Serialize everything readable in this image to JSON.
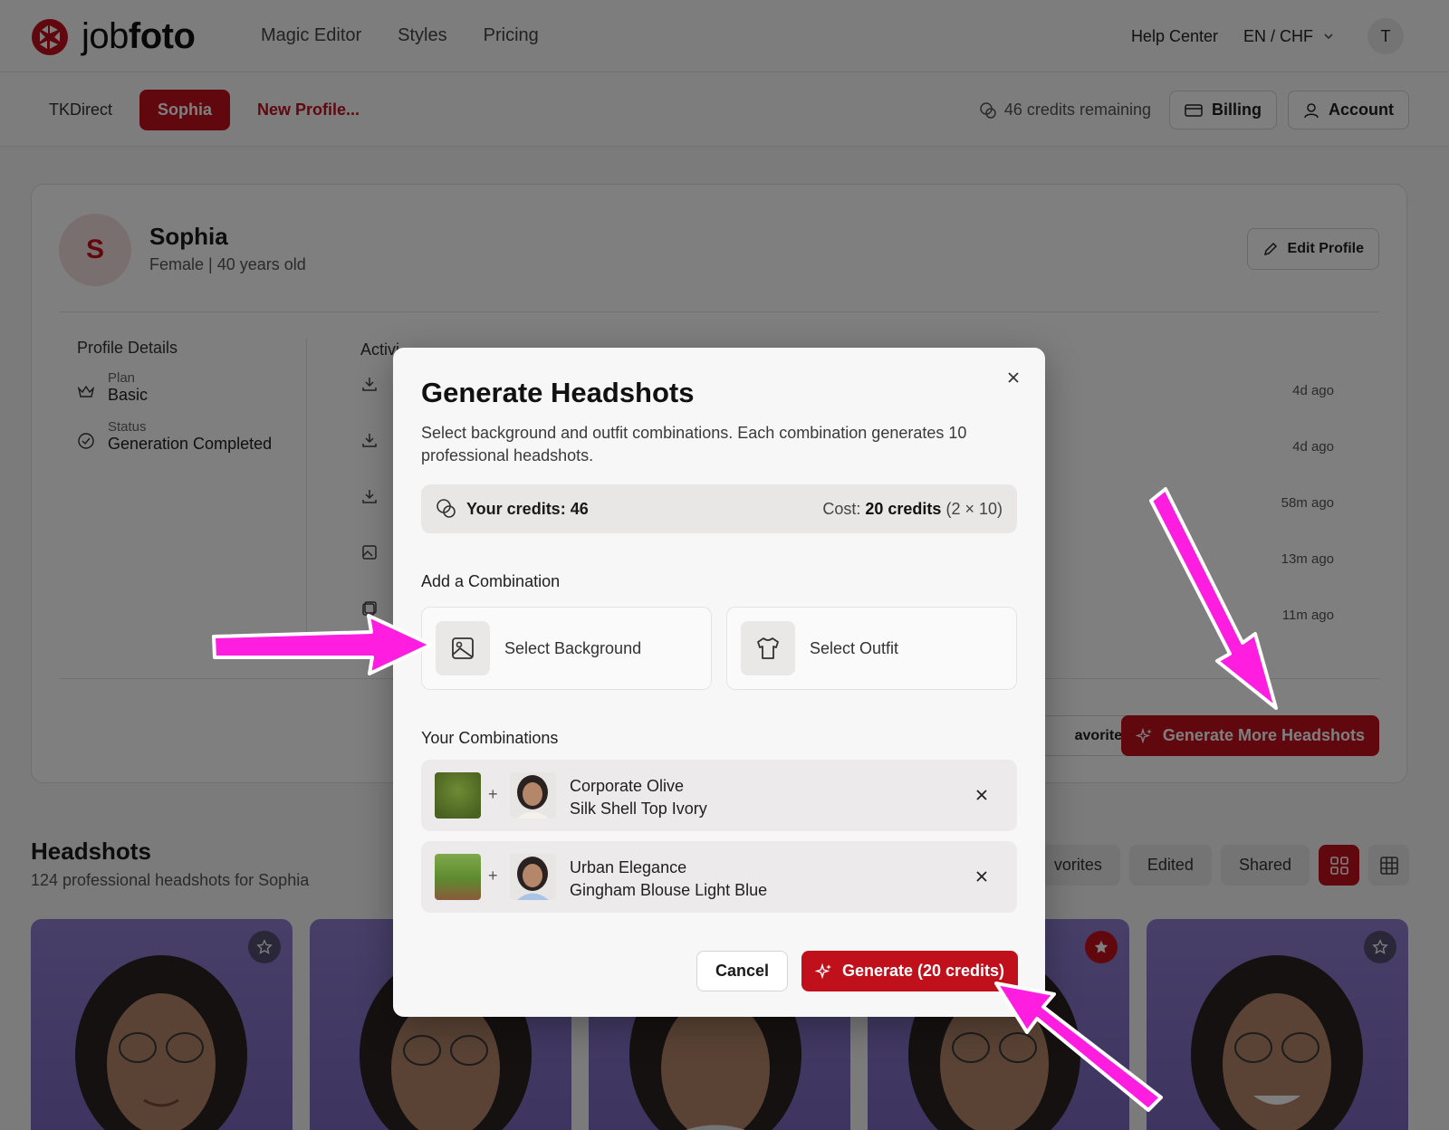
{
  "brand": {
    "name_light": "job",
    "name_bold": "foto",
    "accent": "#c0101c"
  },
  "topnav": {
    "links": [
      "Magic Editor",
      "Styles",
      "Pricing"
    ],
    "help": "Help Center",
    "lang": "EN / CHF",
    "user_initial": "T"
  },
  "subnav": {
    "profiles": [
      "TKDirect",
      "Sophia"
    ],
    "new_profile": "New Profile...",
    "credits_remaining": "46 credits remaining",
    "billing": "Billing",
    "account": "Account"
  },
  "profile": {
    "initial": "S",
    "name": "Sophia",
    "subtitle": "Female | 40 years old",
    "edit": "Edit Profile",
    "details_title": "Profile Details",
    "plan_label": "Plan",
    "plan_value": "Basic",
    "status_label": "Status",
    "status_value": "Generation Completed",
    "activity_title": "Activi",
    "activity_times": [
      "4d ago",
      "4d ago",
      "58m ago",
      "13m ago",
      "11m ago"
    ],
    "favorites_partial": "avorites",
    "generate_more": "Generate More Headshots"
  },
  "headshots": {
    "title": "Headshots",
    "subtitle": "124 professional headshots for Sophia",
    "filters": [
      "vorites",
      "Edited",
      "Shared"
    ]
  },
  "modal": {
    "title": "Generate Headshots",
    "description": "Select background and outfit combinations. Each combination generates 10 professional headshots.",
    "your_credits": "Your credits: 46",
    "cost_label": "Cost:",
    "cost_value": "20 credits",
    "cost_detail": "(2 × 10)",
    "add_combination": "Add a Combination",
    "select_background": "Select Background",
    "select_outfit": "Select Outfit",
    "your_combinations": "Your Combinations",
    "combinations": [
      {
        "background": "Corporate Olive",
        "outfit": "Silk Shell Top Ivory"
      },
      {
        "background": "Urban Elegance",
        "outfit": "Gingham Blouse Light Blue"
      }
    ],
    "cancel": "Cancel",
    "generate": "Generate (20 credits)"
  },
  "annotation_color": "#ff1de0"
}
